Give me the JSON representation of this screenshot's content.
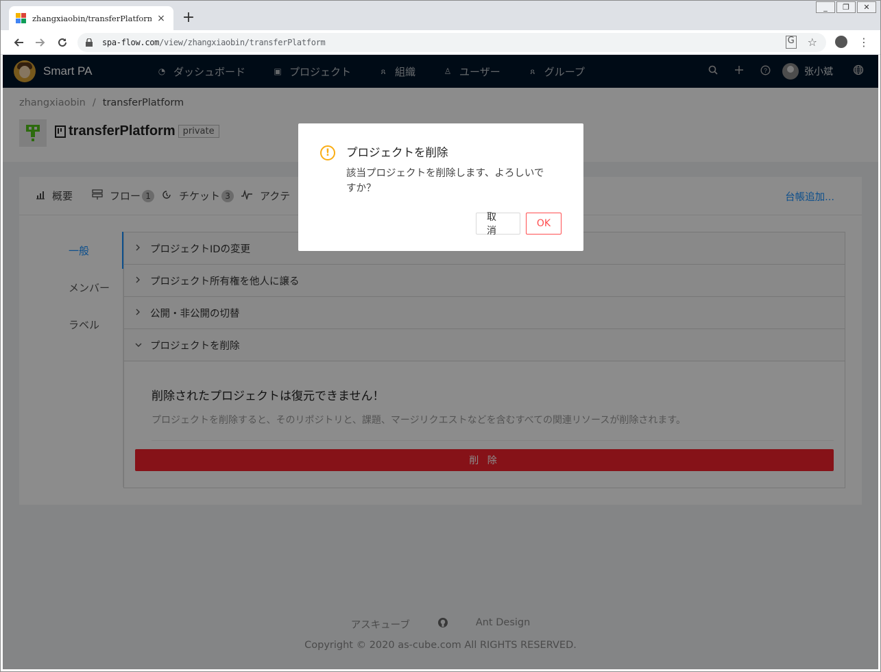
{
  "browser": {
    "tab_title": "zhangxiaobin/transferPlatform",
    "tab_close": "×",
    "new_tab": "+",
    "url_host": "spa-flow.com",
    "url_path": "/view/zhangxiaobin/transferPlatform",
    "window_controls": [
      "_",
      "❐",
      "✕"
    ]
  },
  "header": {
    "brand": "Smart PA",
    "menu": [
      {
        "icon": "dashboard-icon",
        "glyph": "◔",
        "label": "ダッシュボード"
      },
      {
        "icon": "project-icon",
        "glyph": "▣",
        "label": "プロジェクト"
      },
      {
        "icon": "organization-icon",
        "glyph": "ጸ",
        "label": "組織"
      },
      {
        "icon": "user-icon",
        "glyph": "♙",
        "label": "ユーザー"
      },
      {
        "icon": "group-icon",
        "glyph": "ጸ",
        "label": "グループ"
      }
    ],
    "user_name": "张小斌"
  },
  "page": {
    "breadcrumb": [
      "zhangxiaobin",
      "/",
      "transferPlatform"
    ],
    "project_name": "transferPlatform",
    "visibility": "private"
  },
  "tabs": [
    {
      "icon": "overview-icon",
      "glyph": "📶",
      "label": "概要",
      "count": ""
    },
    {
      "icon": "flow-icon",
      "glyph": "☰",
      "label": "フロー",
      "count": "1"
    },
    {
      "icon": "ticket-icon",
      "glyph": "◴",
      "label": "チケット",
      "count": "3"
    },
    {
      "icon": "activity-icon",
      "glyph": "⋀",
      "label": "アクテ",
      "count": ""
    }
  ],
  "tabs_extra": "台帳追加...",
  "sidebar": [
    {
      "label": "一般",
      "active": true
    },
    {
      "label": "メンバー",
      "active": false
    },
    {
      "label": "ラベル",
      "active": false
    }
  ],
  "panels": [
    {
      "label": "プロジェクトIDの変更",
      "arrow": "›"
    },
    {
      "label": "プロジェクト所有権を他人に譲る",
      "arrow": "›"
    },
    {
      "label": "公開・非公開の切替",
      "arrow": "›"
    },
    {
      "label": "プロジェクトを削除",
      "arrow": "⌄"
    }
  ],
  "delete_section": {
    "title": "削除されたプロジェクトは復元できません！",
    "description": "プロジェクトを削除すると、そのリポジトリと、課題、マージリクエストなどを含むすべての関連リソースが削除されます。",
    "button": "削 除"
  },
  "footer": {
    "links": [
      "アスキューブ",
      "Ant Design"
    ],
    "copyright": "Copyright © 2020 as-cube.com All RIGHTS RESERVED."
  },
  "modal": {
    "title": "プロジェクトを削除",
    "content": "該当プロジェクトを削除します、よろしいですか？",
    "cancel": "取 消",
    "ok": "OK",
    "icon": "!"
  },
  "colors": {
    "header_bg": "#001529",
    "primary": "#1890ff",
    "danger": "#f5222d",
    "warning": "#faad14"
  }
}
